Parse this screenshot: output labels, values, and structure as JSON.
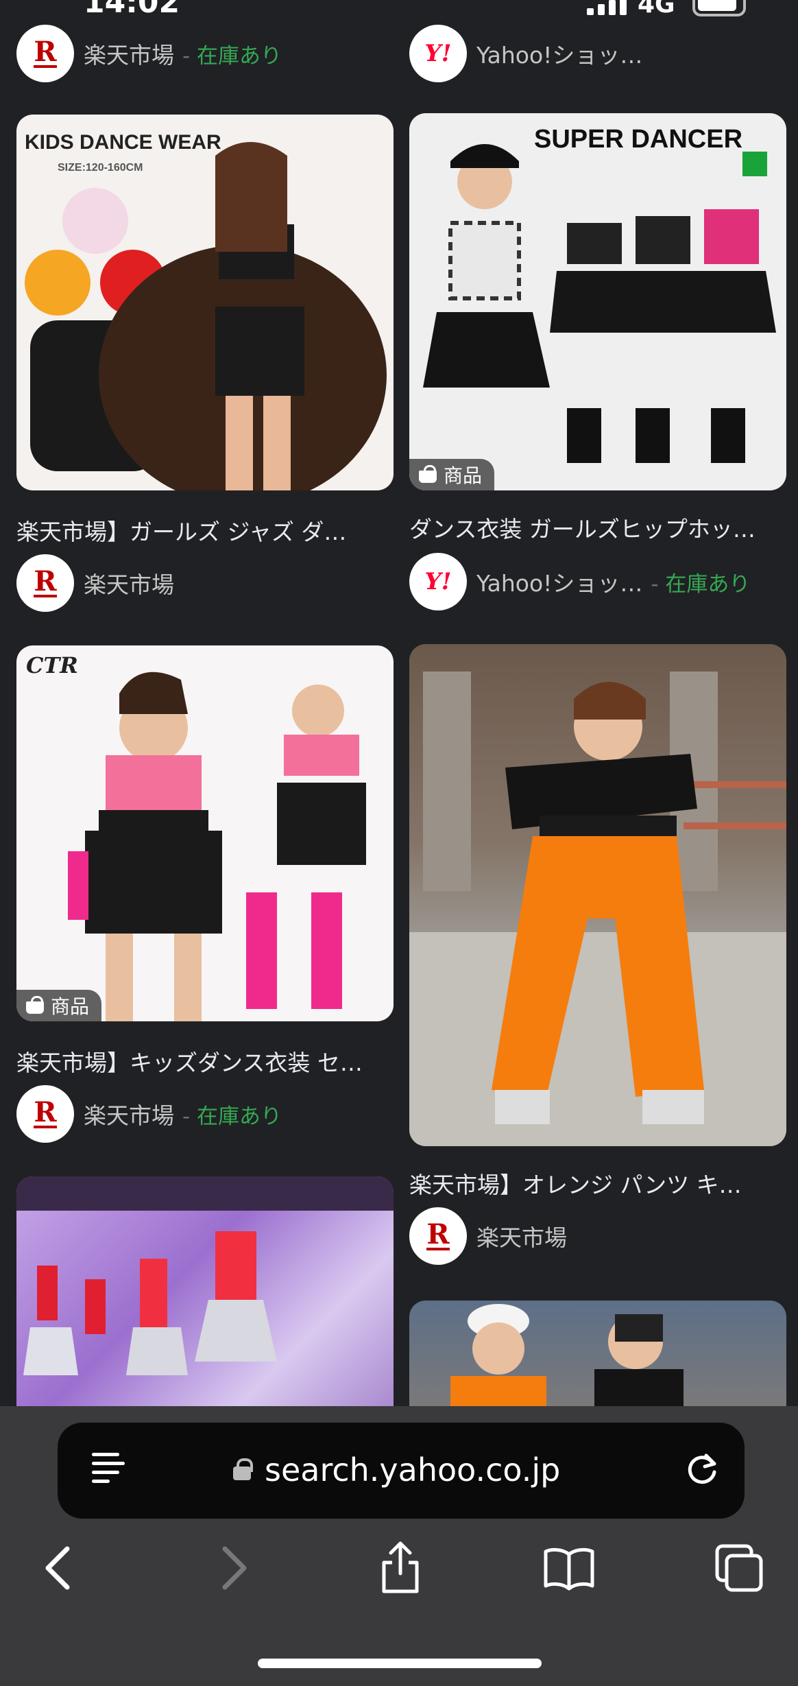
{
  "status_bar": {
    "time": "14:02",
    "network": "4G"
  },
  "results_left": [
    {
      "title": "",
      "source": "楽天市場",
      "stock": "在庫あり"
    },
    {
      "title": "楽天市場】ガールズ ジャズ ダ…",
      "source": "楽天市場",
      "stock": ""
    },
    {
      "title": "楽天市場】キッズダンス衣装 セ…",
      "source": "楽天市場",
      "stock": "在庫あり",
      "badge": "商品"
    }
  ],
  "results_right": [
    {
      "title": "",
      "source": "Yahoo!ショッ…",
      "stock": ""
    },
    {
      "title": "ダンス衣装 ガールズヒップホッ…",
      "source": "Yahoo!ショッ…",
      "stock": "在庫あり",
      "badge": "商品"
    },
    {
      "title": "楽天市場】オレンジ パンツ キ…",
      "source": "楽天市場",
      "stock": ""
    }
  ],
  "image_text": {
    "kids_dance_wear": "KIDS DANCE WEAR",
    "size": "SIZE:120-160CM",
    "super_dancer": "SUPER DANCER",
    "ctr": "CTR"
  },
  "browser": {
    "url": "search.yahoo.co.jp"
  },
  "colors": {
    "background": "#202124",
    "stock_green": "#34a853",
    "toolbar": "#3a3a3c",
    "rakuten_red": "#bf0000",
    "yahoo_red": "#ff0033"
  }
}
